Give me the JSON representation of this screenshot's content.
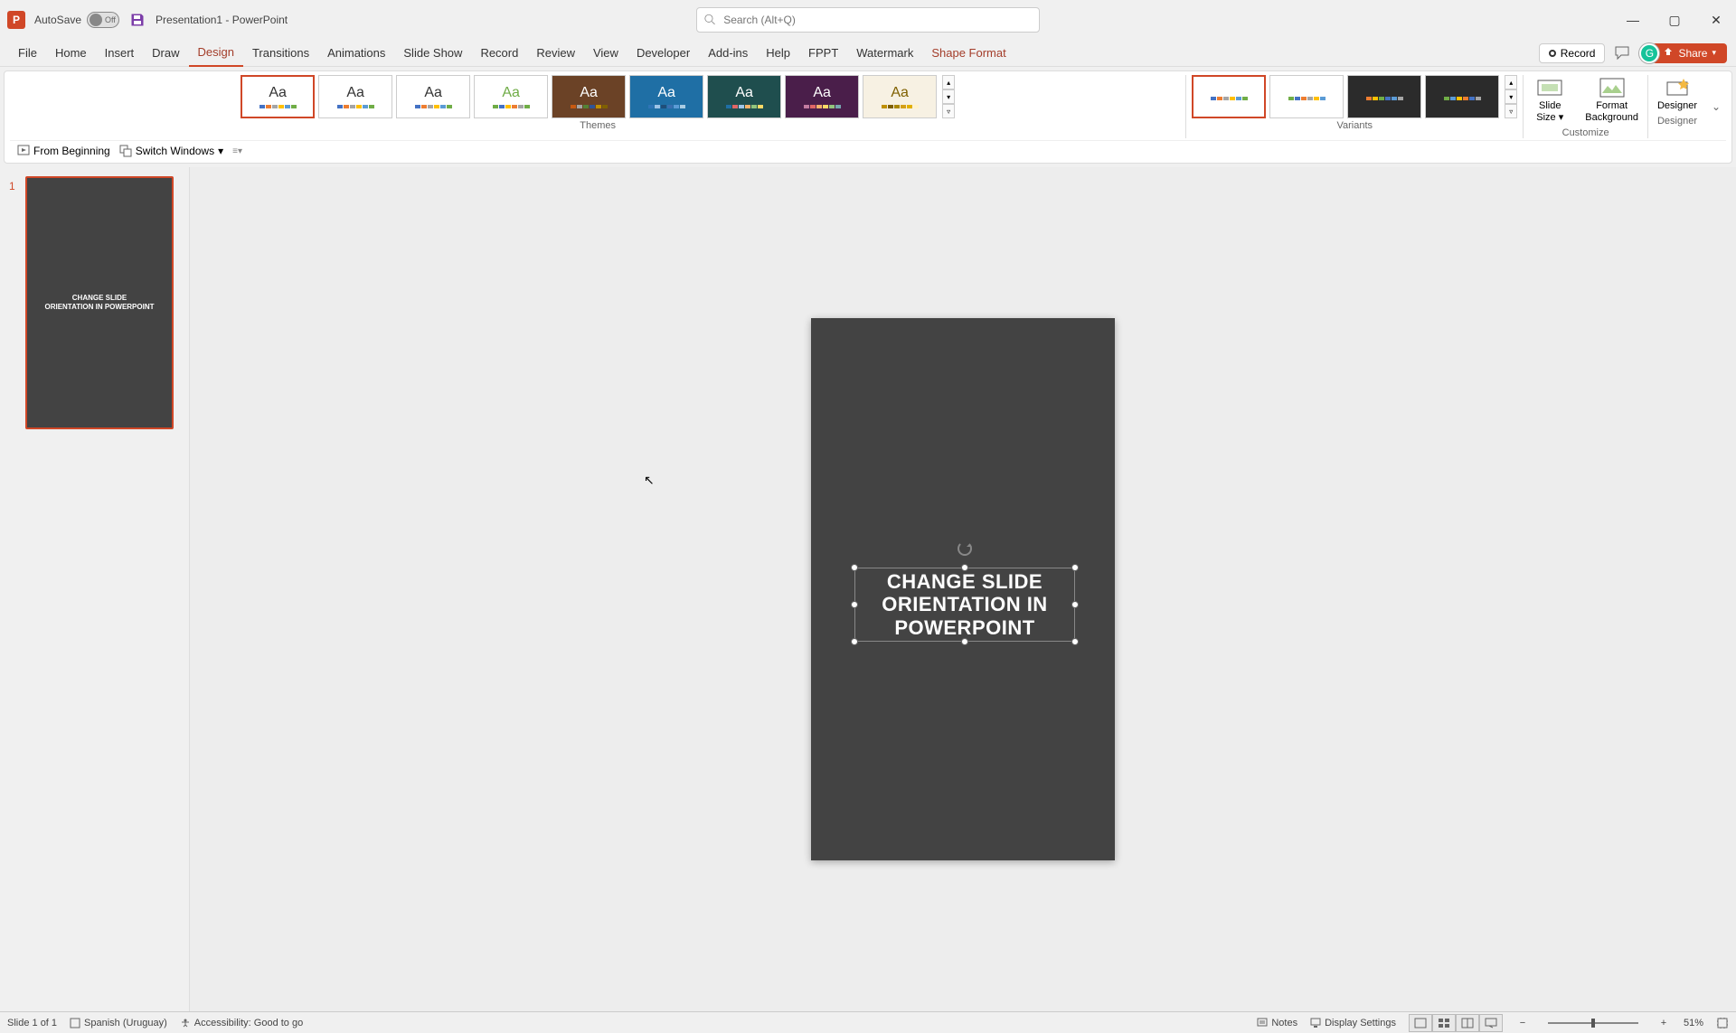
{
  "title_bar": {
    "autosave_label": "AutoSave",
    "autosave_state": "Off",
    "doc_title": "Presentation1 - PowerPoint",
    "search_placeholder": "Search (Alt+Q)"
  },
  "tabs": [
    "File",
    "Home",
    "Insert",
    "Draw",
    "Design",
    "Transitions",
    "Animations",
    "Slide Show",
    "Record",
    "Review",
    "View",
    "Developer",
    "Add-ins",
    "Help",
    "FPPT",
    "Watermark",
    "Shape Format"
  ],
  "active_tab": "Design",
  "contextual_tab": "Shape Format",
  "ribbon_right": {
    "record": "Record",
    "share": "Share"
  },
  "ribbon": {
    "themes_label": "Themes",
    "variants_label": "Variants",
    "customize_label": "Customize",
    "designer_label": "Designer",
    "slide_size": "Slide\nSize",
    "format_background": "Format\nBackground",
    "designer": "Designer"
  },
  "qat": {
    "from_beginning": "From Beginning",
    "switch_windows": "Switch Windows"
  },
  "slide_panel": {
    "slide_number": "1",
    "thumb_text": "CHANGE SLIDE\nORIENTATION IN POWERPOINT"
  },
  "slide_content": {
    "line1": "CHANGE SLIDE",
    "line2": "ORIENTATION IN POWERPOINT"
  },
  "status_bar": {
    "slide": "Slide 1 of 1",
    "language": "Spanish (Uruguay)",
    "accessibility": "Accessibility: Good to go",
    "notes": "Notes",
    "display_settings": "Display Settings",
    "zoom_pct": "51%"
  },
  "theme_colors": [
    [
      "#4472c4",
      "#ed7d31",
      "#a5a5a5",
      "#ffc000",
      "#5b9bd5",
      "#70ad47"
    ],
    [
      "#4472c4",
      "#ed7d31",
      "#a5a5a5",
      "#ffc000",
      "#5b9bd5",
      "#70ad47"
    ],
    [
      "#4472c4",
      "#ed7d31",
      "#a5a5a5",
      "#ffc000",
      "#5b9bd5",
      "#70ad47"
    ],
    [
      "#6fac46",
      "#4472c4",
      "#ffc000",
      "#ed7d31",
      "#a5a5a5",
      "#70ad47"
    ],
    [
      "#c65911",
      "#a5a5a5",
      "#548235",
      "#305496",
      "#bf8f00",
      "#806000"
    ],
    [
      "#2e75b6",
      "#9dc3e6",
      "#1f4e79",
      "#3a6fb0",
      "#5b9bd5",
      "#a9cce3"
    ],
    [
      "#1f6fa5",
      "#e06666",
      "#9fc5e8",
      "#f6b26b",
      "#93c47d",
      "#ffd966"
    ],
    [
      "#c27ba0",
      "#e06666",
      "#f6b26b",
      "#ffd966",
      "#93c47d",
      "#76a5af"
    ],
    [
      "#bf9000",
      "#7f6000",
      "#a98600",
      "#d4a017",
      "#e1b000",
      "#fff2cc"
    ]
  ],
  "theme_bgs": [
    "#ffffff",
    "#ffffff",
    "#ffffff",
    "#ffffff",
    "#6b4226",
    "#1f6fa5",
    "#1f4e4e",
    "#4a1e4a",
    "#f7f1e3"
  ],
  "theme_aa_colors": [
    "#333",
    "#333",
    "#333",
    "#6fac46",
    "#fff",
    "#fff",
    "#fff",
    "#fff",
    "#7f6000"
  ],
  "variant_bgs": [
    "#ffffff",
    "#ffffff",
    "#2b2b2b",
    "#2b2b2b"
  ],
  "variant_colors": [
    [
      "#4472c4",
      "#ed7d31",
      "#a5a5a5",
      "#ffc000",
      "#5b9bd5",
      "#70ad47"
    ],
    [
      "#70ad47",
      "#4472c4",
      "#ed7d31",
      "#a5a5a5",
      "#ffc000",
      "#5b9bd5"
    ],
    [
      "#ed7d31",
      "#ffc000",
      "#70ad47",
      "#4472c4",
      "#5b9bd5",
      "#a5a5a5"
    ],
    [
      "#70ad47",
      "#5b9bd5",
      "#ffc000",
      "#ed7d31",
      "#4472c4",
      "#a5a5a5"
    ]
  ]
}
